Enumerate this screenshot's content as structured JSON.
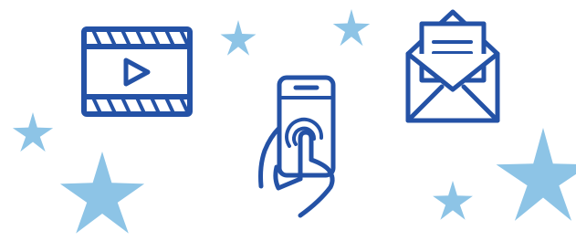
{
  "colors": {
    "line": "#2452A6",
    "star": "#8DC4E6",
    "background": "#FFFFFF"
  },
  "icons": [
    "video-icon",
    "phone-touch-icon",
    "mail-icon",
    "star-icon"
  ]
}
